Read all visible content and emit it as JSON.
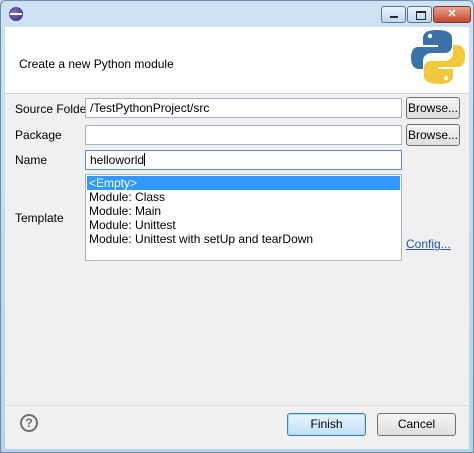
{
  "window": {
    "title": "",
    "controls": {
      "minimize": "",
      "maximize": "",
      "close": "✕"
    }
  },
  "banner": {
    "text": "Create a new Python module",
    "logo": "python-logo"
  },
  "form": {
    "source_folder": {
      "label": "Source Folder",
      "value": "/TestPythonProject/src",
      "browse_label": "Browse..."
    },
    "package": {
      "label": "Package",
      "value": "",
      "browse_label": "Browse..."
    },
    "name": {
      "label": "Name",
      "value": "helloworld"
    },
    "template": {
      "label": "Template",
      "items": [
        "<Empty>",
        "Module: Class",
        "Module: Main",
        "Module: Unittest",
        "Module: Unittest with setUp and tearDown"
      ],
      "selected_index": 0,
      "config_link": "Config..."
    }
  },
  "footer": {
    "help": "?",
    "finish_label": "Finish",
    "cancel_label": "Cancel"
  },
  "colors": {
    "selection": "#3399ff",
    "link": "#1a59b7",
    "python_blue": "#3b73a8",
    "python_yellow": "#f0c93a"
  }
}
